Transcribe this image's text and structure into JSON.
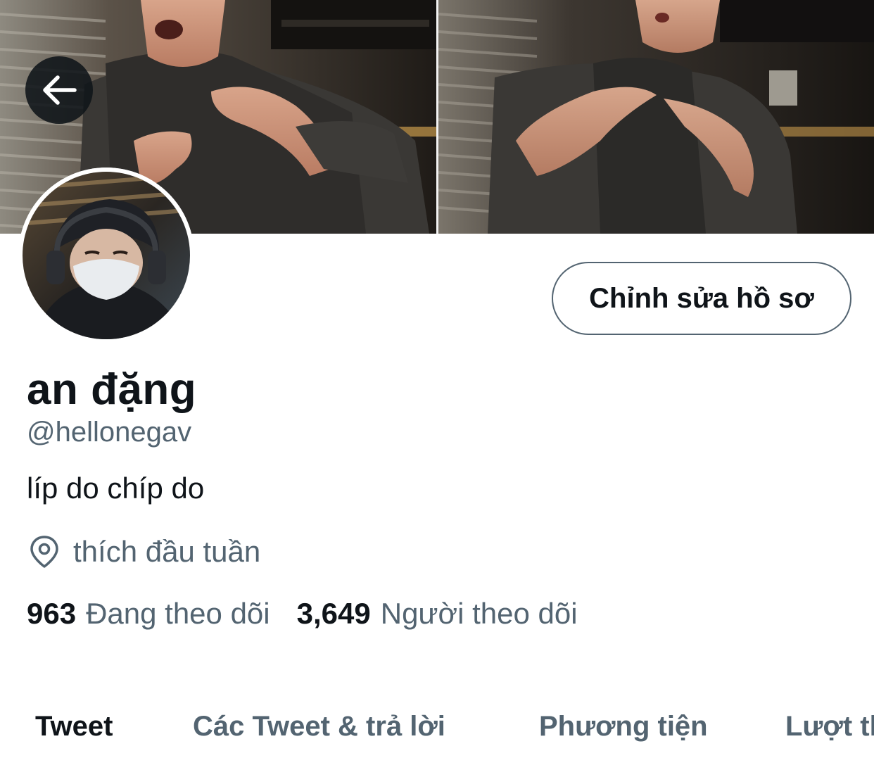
{
  "profile": {
    "display_name": "an đặng",
    "handle": "@hellonegav",
    "bio": "líp do chíp do",
    "location": "thích đầu tuần",
    "edit_button_label": "Chỉnh sửa hồ sơ"
  },
  "stats": {
    "following_count": "963",
    "following_label": "Đang theo dõi",
    "followers_count": "3,649",
    "followers_label": "Người theo dõi"
  },
  "tabs": [
    {
      "label": "Tweet",
      "active": true
    },
    {
      "label": "Các Tweet & trả lời",
      "active": false
    },
    {
      "label": "Phương tiện",
      "active": false
    },
    {
      "label": "Lượt thích",
      "active": false
    }
  ],
  "icons": {
    "back": "arrow-left-icon",
    "location": "map-pin-icon"
  },
  "colors": {
    "text_primary": "#0f1419",
    "text_secondary": "#536471",
    "back_button_bg": "#0f1419"
  }
}
